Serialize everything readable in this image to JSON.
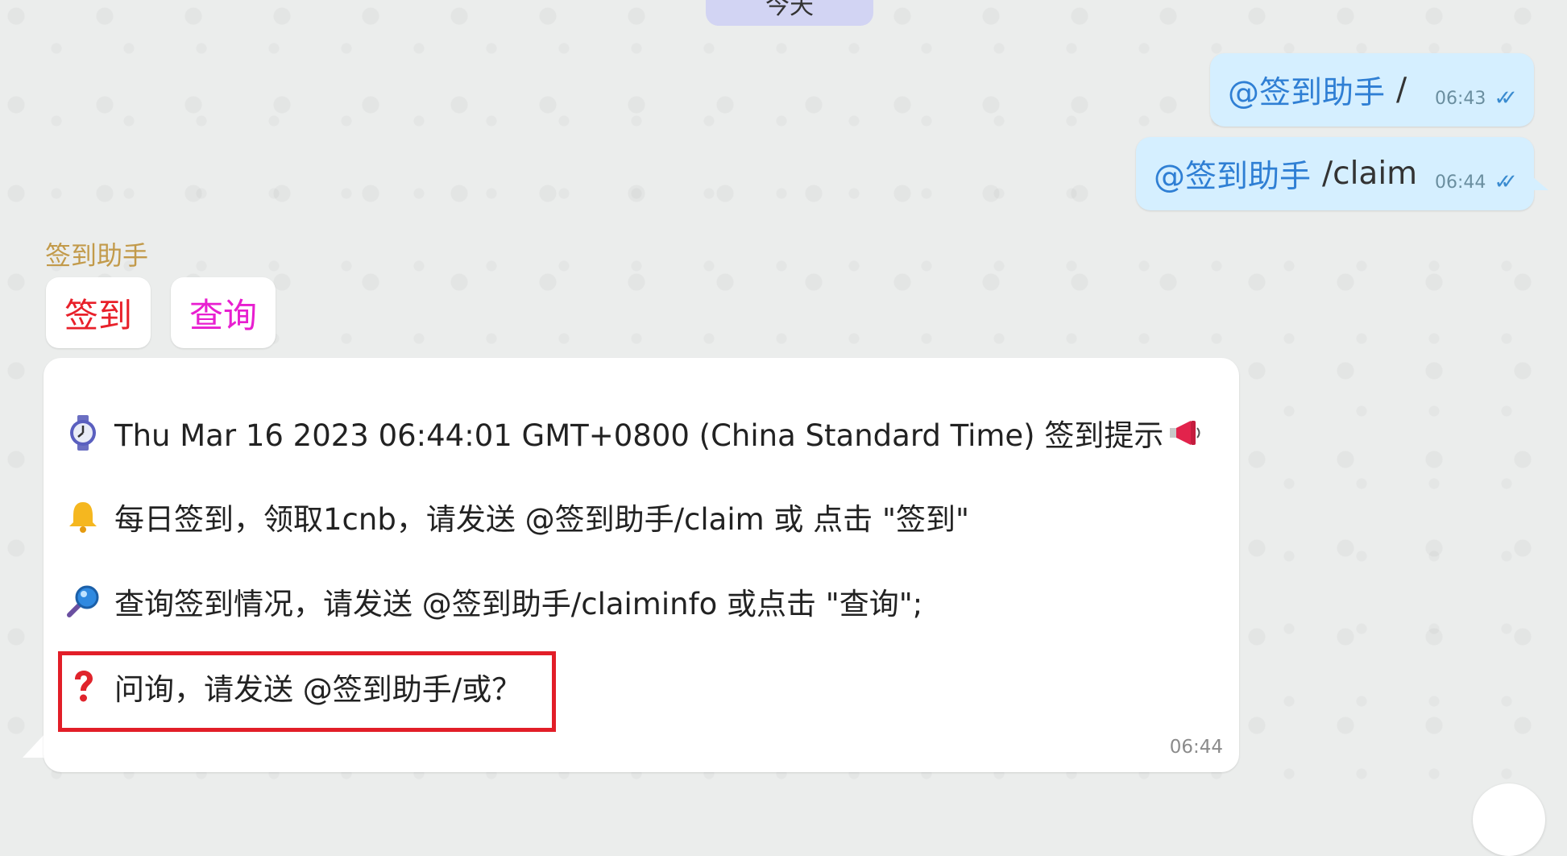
{
  "date_separator": "今天",
  "outgoing_messages": [
    {
      "mention": "@签到助手",
      "text": "/",
      "time": "06:43",
      "status_icon": "double-check-icon"
    },
    {
      "mention": "@签到助手",
      "text": "/claim",
      "time": "06:44",
      "status_icon": "double-check-icon"
    }
  ],
  "incoming": {
    "sender": "签到助手",
    "keyboard_buttons": [
      {
        "label": "签到",
        "color": "#e8202a"
      },
      {
        "label": "查询",
        "color": "#e81fd0"
      }
    ],
    "lines": [
      {
        "icon": "watch-icon",
        "text": "Thu Mar 16 2023 06:44:01 GMT+0800 (China Standard Time) 签到提示"
      },
      {
        "icon": "bell-icon",
        "text": "每日签到，领取1cnb，请发送 @签到助手/claim 或 点击 \"签到\""
      },
      {
        "icon": "magnifier-icon",
        "text": "查询签到情况，请发送 @签到助手/claiminfo 或点击 \"查询\";"
      },
      {
        "icon": "question-mark-icon",
        "text": "问询，请发送 @签到助手/或？"
      }
    ],
    "trailing_icon": "megaphone-icon",
    "time": "06:44"
  },
  "colors": {
    "outgoing_bubble": "#d5efff",
    "mention": "#2f7fd4",
    "sender_name": "#c29a4a",
    "highlight_box": "#e21e28"
  }
}
